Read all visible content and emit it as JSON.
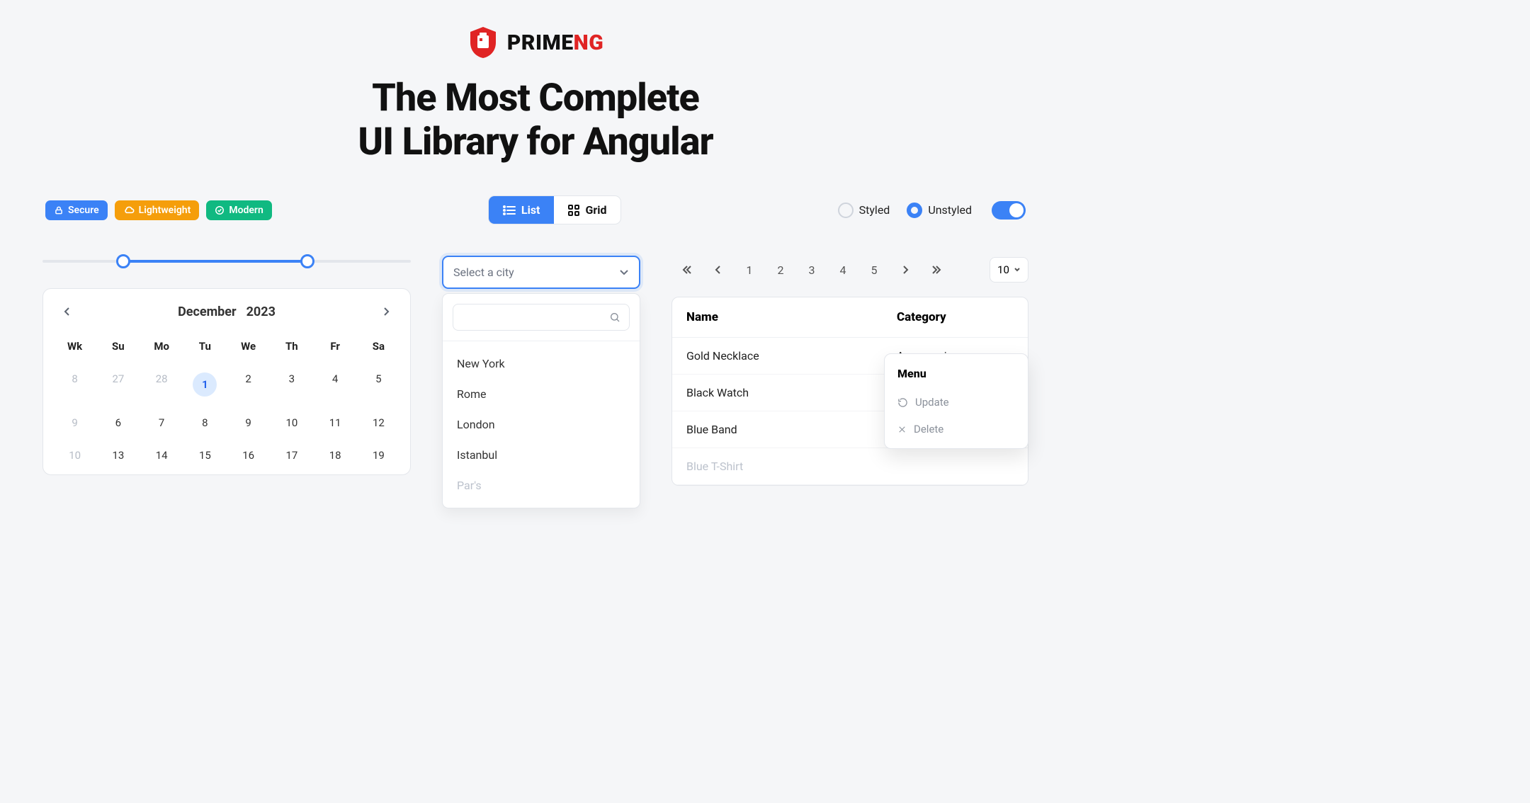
{
  "brand": {
    "name_a": "PRIME",
    "name_b": "NG"
  },
  "headline": {
    "line1": "The Most Complete",
    "line2": "UI Library for Angular"
  },
  "badges": [
    {
      "label": "Secure",
      "color": "blue",
      "icon": "lock-icon"
    },
    {
      "label": "Lightweight",
      "color": "orange",
      "icon": "cloud-icon"
    },
    {
      "label": "Modern",
      "color": "green",
      "icon": "check-circle-icon"
    }
  ],
  "segmented": {
    "list": "List",
    "grid": "Grid",
    "active": "list"
  },
  "radios": {
    "styled": "Styled",
    "unstyled": "Unstyled",
    "selected": "unstyled"
  },
  "switch_on": true,
  "calendar": {
    "month": "December",
    "year": "2023",
    "dow": [
      "Wk",
      "Su",
      "Mo",
      "Tu",
      "We",
      "Th",
      "Fr",
      "Sa"
    ],
    "rows": [
      [
        {
          "v": "8",
          "m": true
        },
        {
          "v": "27",
          "m": true
        },
        {
          "v": "28",
          "m": true
        },
        {
          "v": "1",
          "hl": true
        },
        {
          "v": "2"
        },
        {
          "v": "3"
        },
        {
          "v": "4"
        },
        {
          "v": "5"
        }
      ],
      [
        {
          "v": "9",
          "m": true
        },
        {
          "v": "6"
        },
        {
          "v": "7"
        },
        {
          "v": "8"
        },
        {
          "v": "9"
        },
        {
          "v": "10"
        },
        {
          "v": "11"
        },
        {
          "v": "12"
        }
      ],
      [
        {
          "v": "10",
          "m": true
        },
        {
          "v": "13"
        },
        {
          "v": "14"
        },
        {
          "v": "15"
        },
        {
          "v": "16"
        },
        {
          "v": "17"
        },
        {
          "v": "18"
        },
        {
          "v": "19"
        }
      ]
    ]
  },
  "dropdown": {
    "placeholder": "Select a city",
    "items": [
      "New York",
      "Rome",
      "London",
      "Istanbul"
    ],
    "fade_item": "Par's"
  },
  "pager": {
    "pages": [
      "1",
      "2",
      "3",
      "4",
      "5"
    ],
    "size": "10"
  },
  "table": {
    "headers": {
      "name": "Name",
      "category": "Category"
    },
    "rows": [
      {
        "name": "Gold Necklace",
        "category": "Accessories"
      },
      {
        "name": "Black Watch",
        "category": ""
      },
      {
        "name": "Blue Band",
        "category": ""
      },
      {
        "name": "Blue T-Shirt",
        "category": "",
        "fade": true
      }
    ]
  },
  "menu": {
    "title": "Menu",
    "update": "Update",
    "delete": "Delete"
  }
}
